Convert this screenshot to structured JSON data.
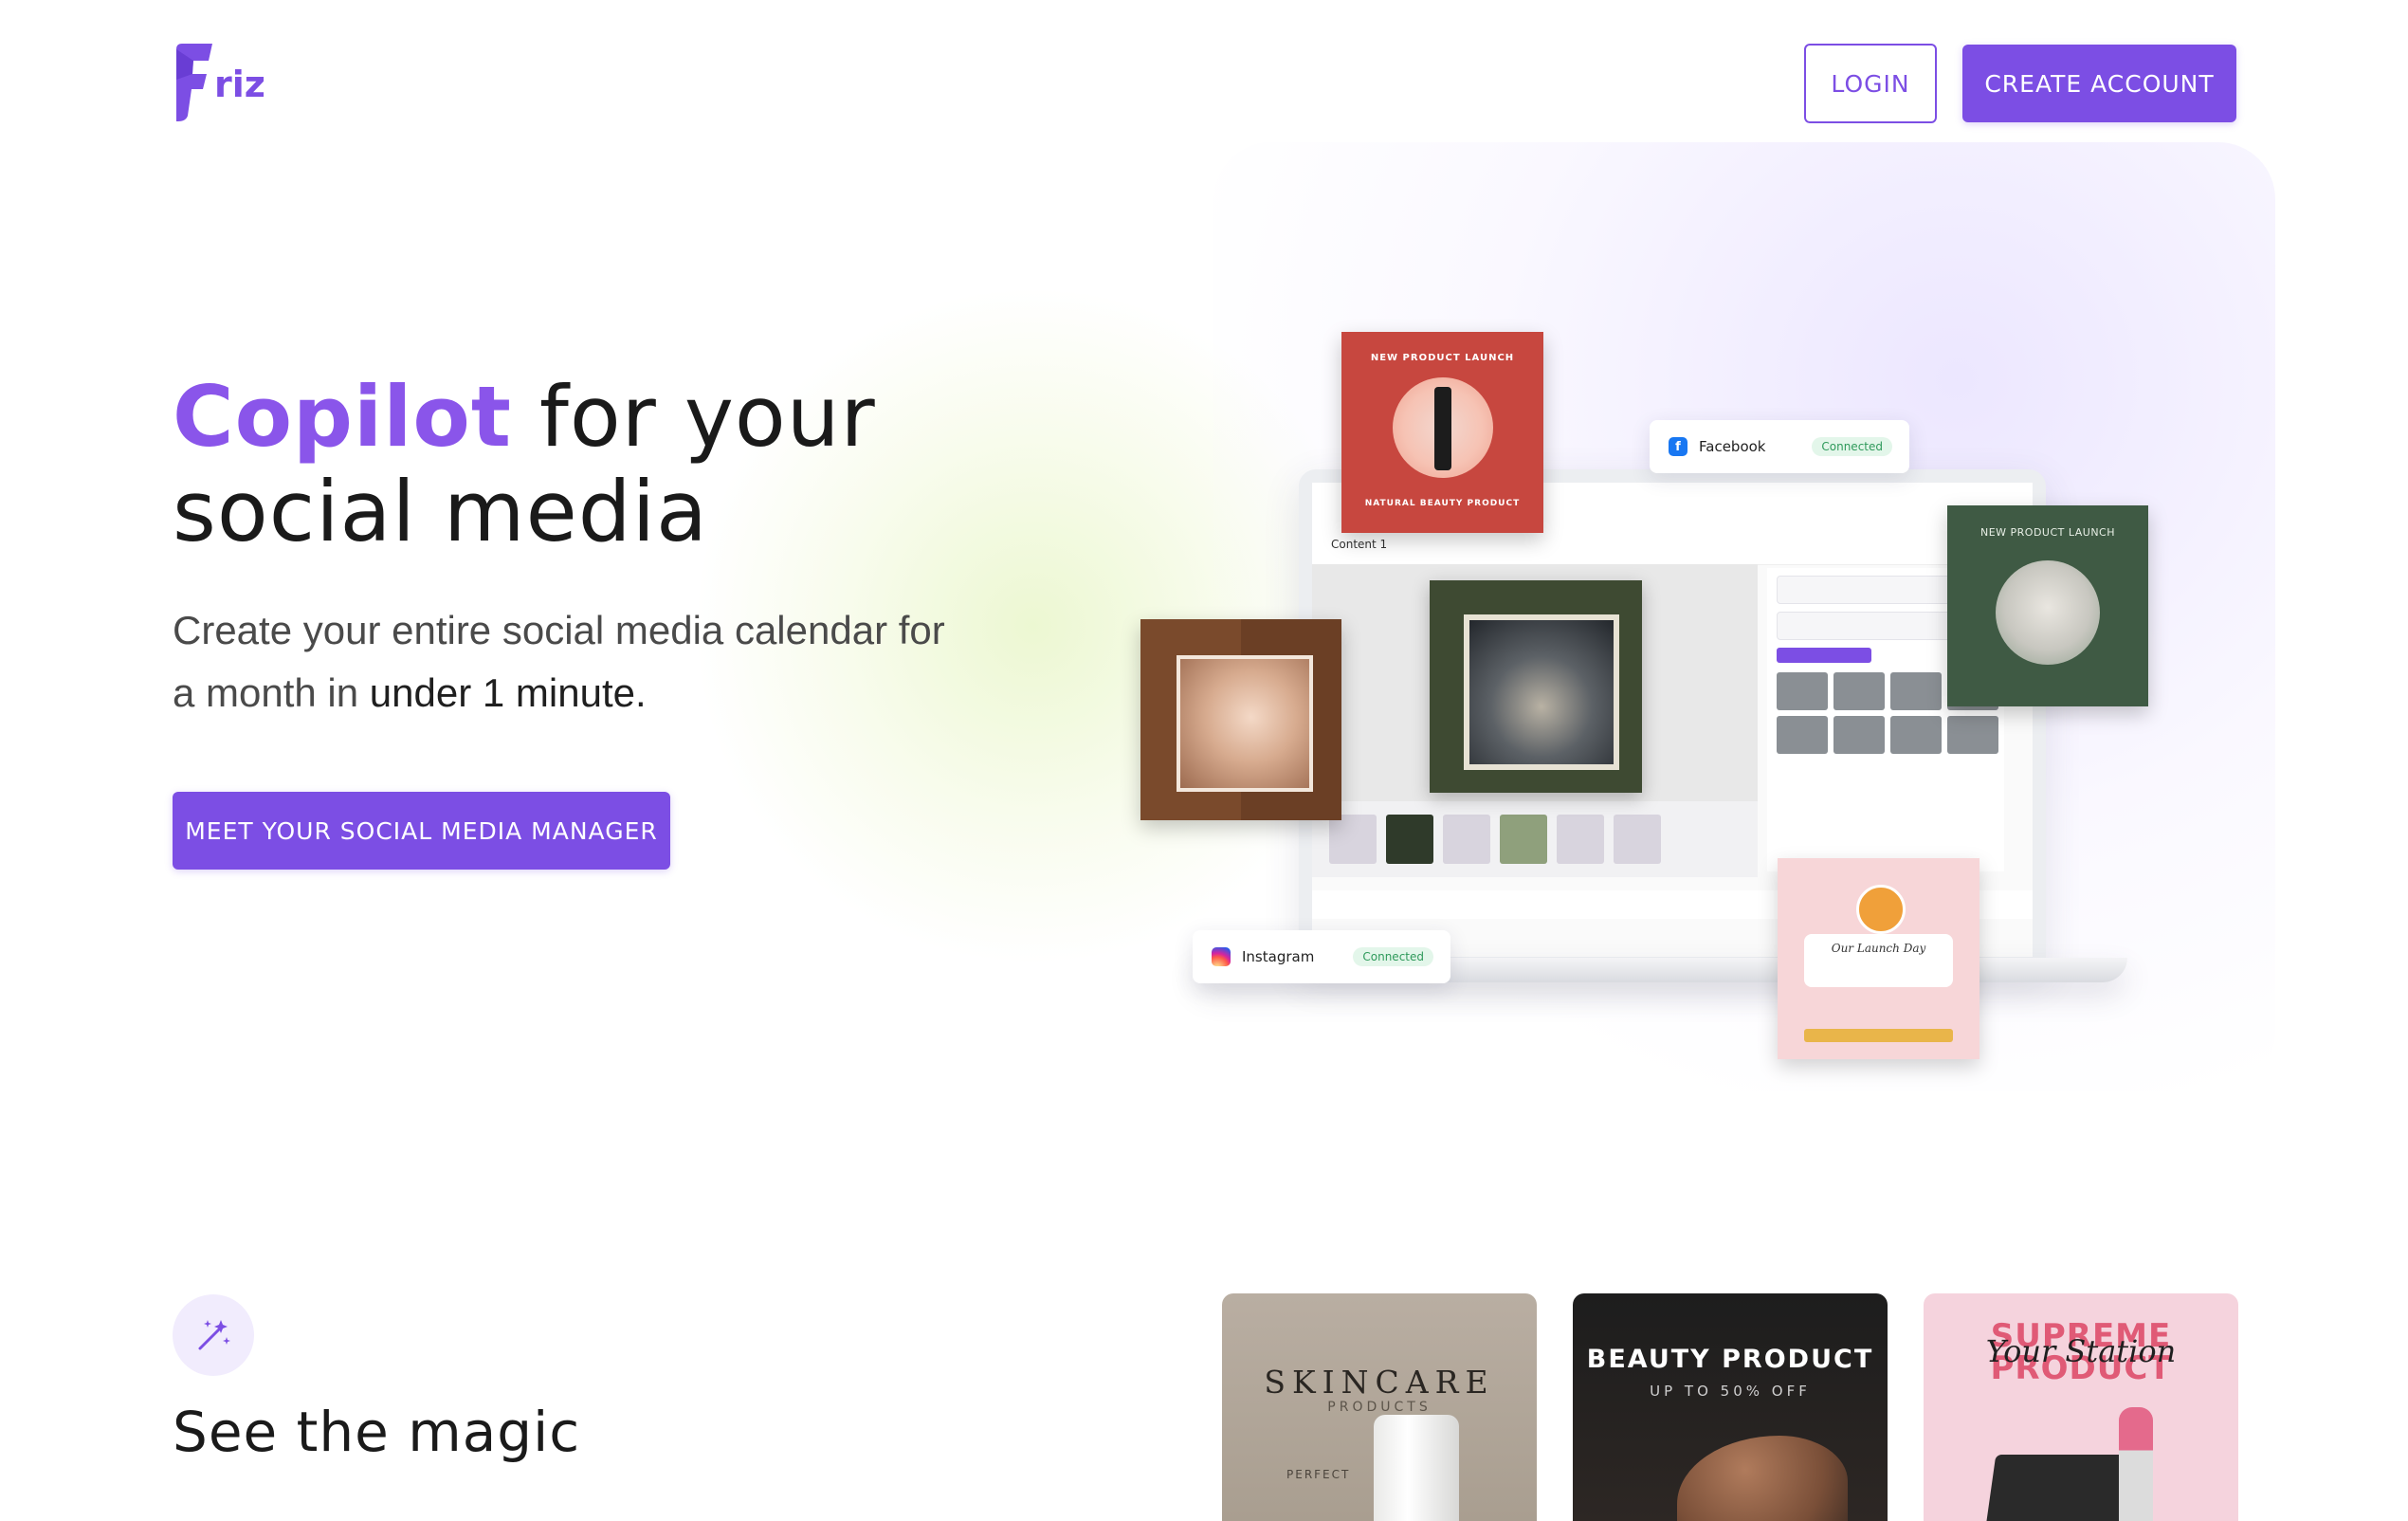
{
  "brand": {
    "name": "Friz",
    "logo_letter": "F",
    "logo_suffix": "riz",
    "accent_color": "#7c4ee4"
  },
  "header": {
    "login_label": "LOGIN",
    "create_account_label": "CREATE ACCOUNT"
  },
  "hero": {
    "title_accent": "Copilot",
    "title_line1_rest": " for your",
    "title_line2": "social media",
    "subtitle_lead": "Create your entire social media calendar for a month in ",
    "subtitle_emphasis": "under 1 minute.",
    "cta_label": "MEET YOUR SOCIAL MEDIA MANAGER"
  },
  "mockup": {
    "facebook": {
      "name": "Facebook",
      "status": "Connected",
      "icon": "facebook-icon"
    },
    "instagram": {
      "name": "Instagram",
      "status": "Connected",
      "icon": "instagram-icon"
    },
    "editor_tab": "Content 1",
    "post_red": {
      "headline": "NEW PRODUCT LAUNCH",
      "footer": "NATURAL BEAUTY PRODUCT"
    },
    "post_green": {
      "headline": "NEW PRODUCT LAUNCH"
    },
    "post_pink": {
      "headline": "Our Launch Day"
    }
  },
  "section_magic": {
    "icon": "magic-wand-icon",
    "title": "See the magic",
    "tiles": [
      {
        "title": "SKINCARE",
        "subtitle": "PRODUCTS",
        "footer": "PERFECT"
      },
      {
        "title": "BEAUTY PRODUCT",
        "subtitle": "UP TO 50% OFF"
      },
      {
        "title": "SUPREME PRODUCT",
        "script": "Your Station"
      }
    ]
  }
}
